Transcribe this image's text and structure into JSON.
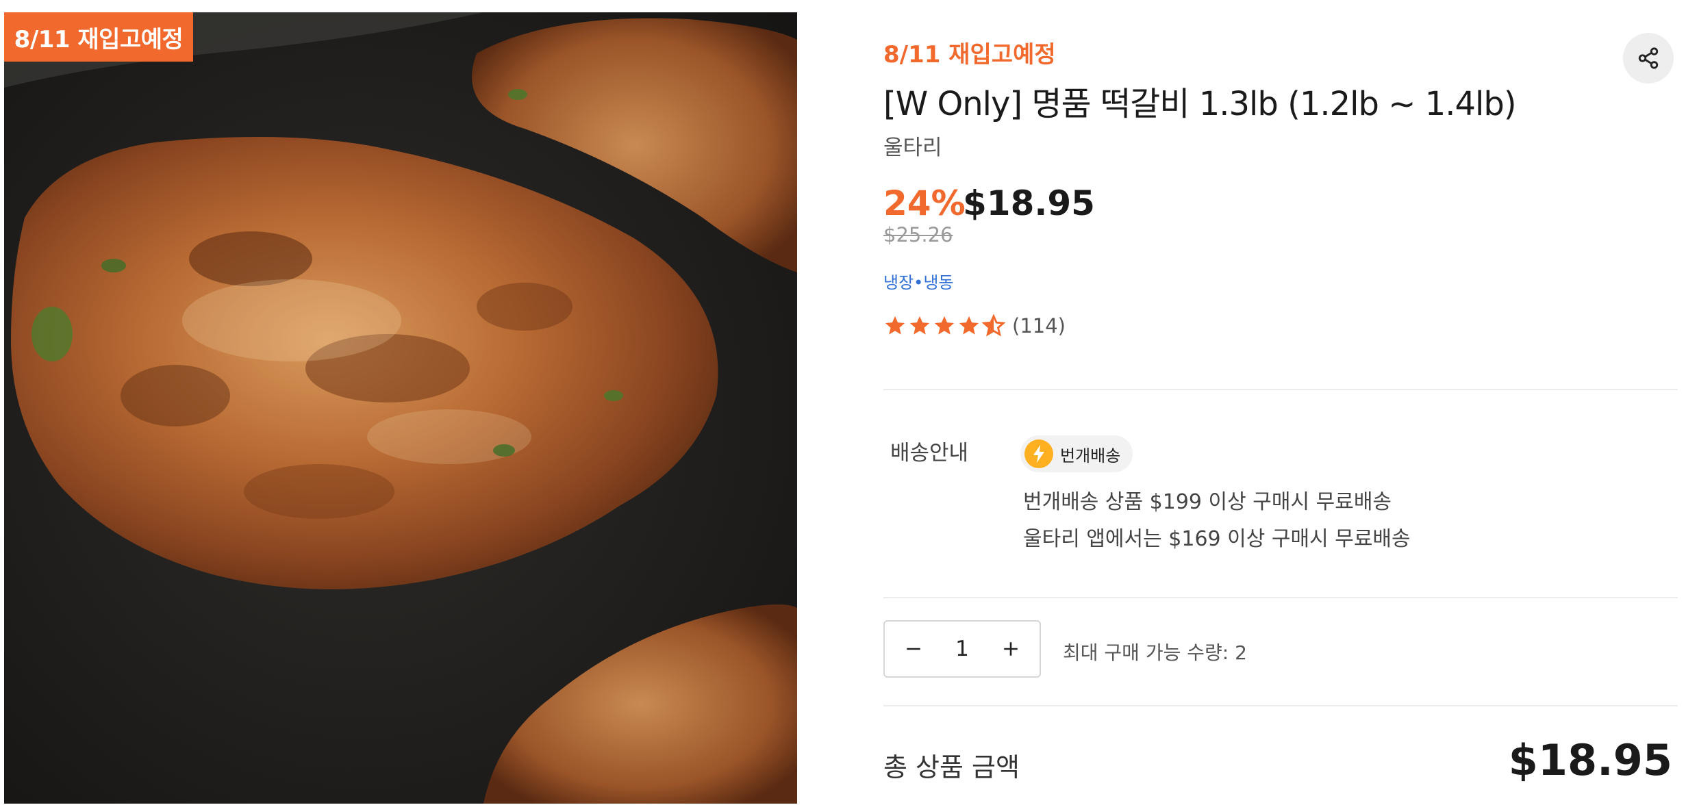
{
  "image": {
    "tag": "8/11 재입고예정"
  },
  "product": {
    "restock_note": "8/11 재입고예정",
    "title": "[W Only] 명품 떡갈비 1.3lb (1.2lb ~ 1.4lb)",
    "brand": "울타리",
    "discount": "24%",
    "price": "$18.95",
    "original_price": "$25.26",
    "storage": "냉장•냉동",
    "rating": {
      "stars": 4.5,
      "count_text": "(114)"
    }
  },
  "shipping": {
    "label": "배송안내",
    "badge": "번개배송",
    "line1": "번개배송 상품 $199 이상 구매시 무료배송",
    "line2": "울타리 앱에서는 $169 이상 구매시 무료배송"
  },
  "quantity": {
    "value": "1",
    "max_text": "최대 구매 가능 수량: 2"
  },
  "total": {
    "label": "총 상품 금액",
    "price": "$18.95"
  },
  "colors": {
    "accent": "#f2692d",
    "link": "#2f6fd6",
    "bolt": "#ffb020"
  },
  "icons": {
    "share": "share-icon",
    "bolt": "lightning-bolt-icon",
    "minus": "minus-icon",
    "plus": "plus-icon",
    "star": "star-icon"
  }
}
